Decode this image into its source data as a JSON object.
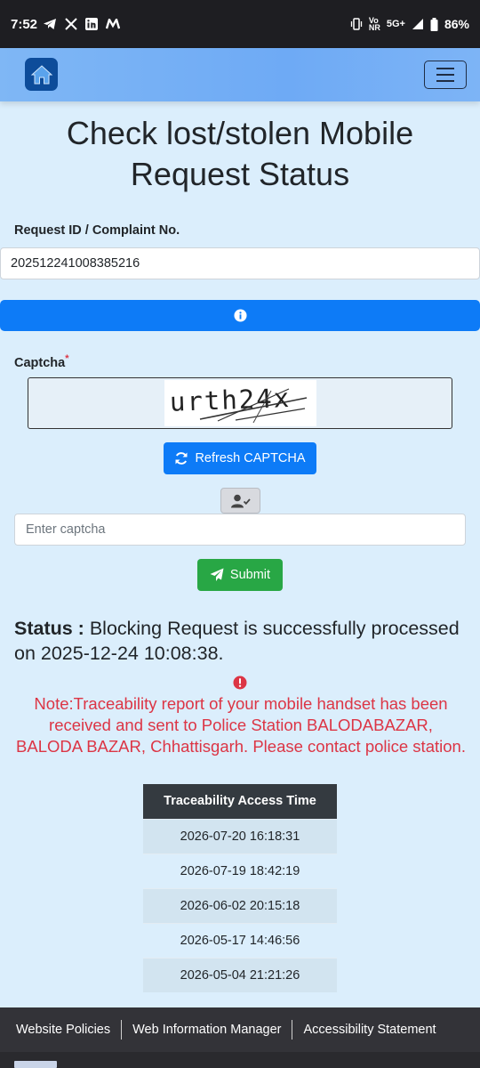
{
  "status_bar": {
    "time": "7:52",
    "app_icons": [
      "telegram-icon",
      "x-icon",
      "linkedin-icon",
      "m-app-icon"
    ],
    "net_top": "Vo",
    "net_bottom": "NR",
    "network": "5G+",
    "battery": "86%"
  },
  "navbar": {
    "home_icon": "home-icon",
    "menu_icon": "hamburger-icon"
  },
  "page": {
    "title_line1": "Check lost/stolen Mobile",
    "title_line2": "Request Status"
  },
  "form": {
    "request_label": "Request ID / Complaint No.",
    "request_value": "202512241008385216",
    "captcha_label": "Captcha",
    "captcha_required_mark": "*",
    "captcha_text": "urth24x",
    "refresh_label": "Refresh CAPTCHA",
    "captcha_placeholder": "Enter captcha",
    "submit_label": "Submit"
  },
  "status": {
    "prefix": "Status :",
    "message": "Blocking Request is successfully processed on 2025-12-24 10:08:38."
  },
  "note": {
    "text": "Note:Traceability report of your mobile handset has been received and sent to Police Station BALODABAZAR, BALODA BAZAR, Chhattisgarh. Please contact police station."
  },
  "trace_table": {
    "header": "Traceability Access Time",
    "rows": [
      "2026-07-20 16:18:31",
      "2026-07-19 18:42:19",
      "2026-06-02 20:15:18",
      "2026-05-17 14:46:56",
      "2026-05-04 21:21:26"
    ]
  },
  "footer": {
    "links": [
      "Website Policies",
      "Web Information Manager",
      "Accessibility Statement"
    ]
  },
  "colors": {
    "primary": "#0d7bf7",
    "success": "#28a745",
    "danger": "#dc3545",
    "background": "#dbeefc"
  }
}
